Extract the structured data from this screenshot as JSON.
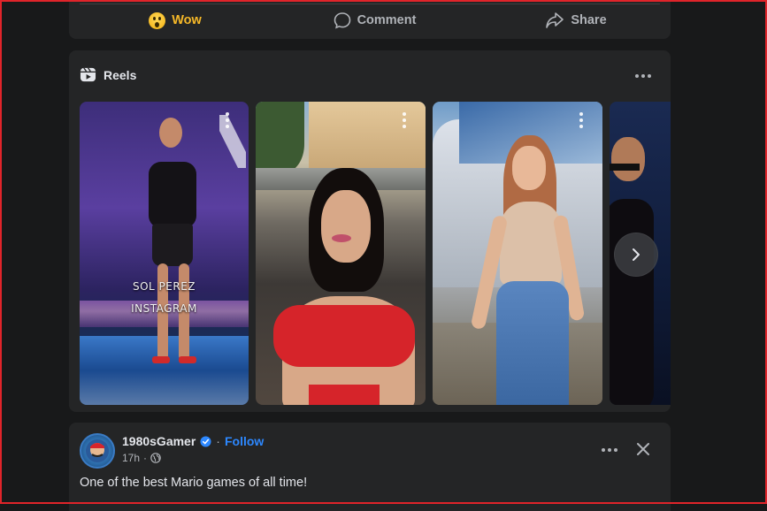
{
  "post_actions": {
    "wow_label": "Wow",
    "comment_label": "Comment",
    "share_label": "Share",
    "wow_color": "#f7b928"
  },
  "reels": {
    "title": "Reels",
    "items": [
      {
        "overlay_lines": [
          "SOL PEREZ",
          "INSTAGRAM"
        ]
      },
      {
        "overlay_lines": []
      },
      {
        "overlay_lines": []
      },
      {
        "overlay_lines": []
      }
    ],
    "next_icon": "chevron-right-icon"
  },
  "post": {
    "author": "1980sGamer",
    "separator": "·",
    "follow_label": "Follow",
    "time": "17h",
    "text": "One of the best Mario games of all time!",
    "verified_color": "#2d88ff"
  }
}
